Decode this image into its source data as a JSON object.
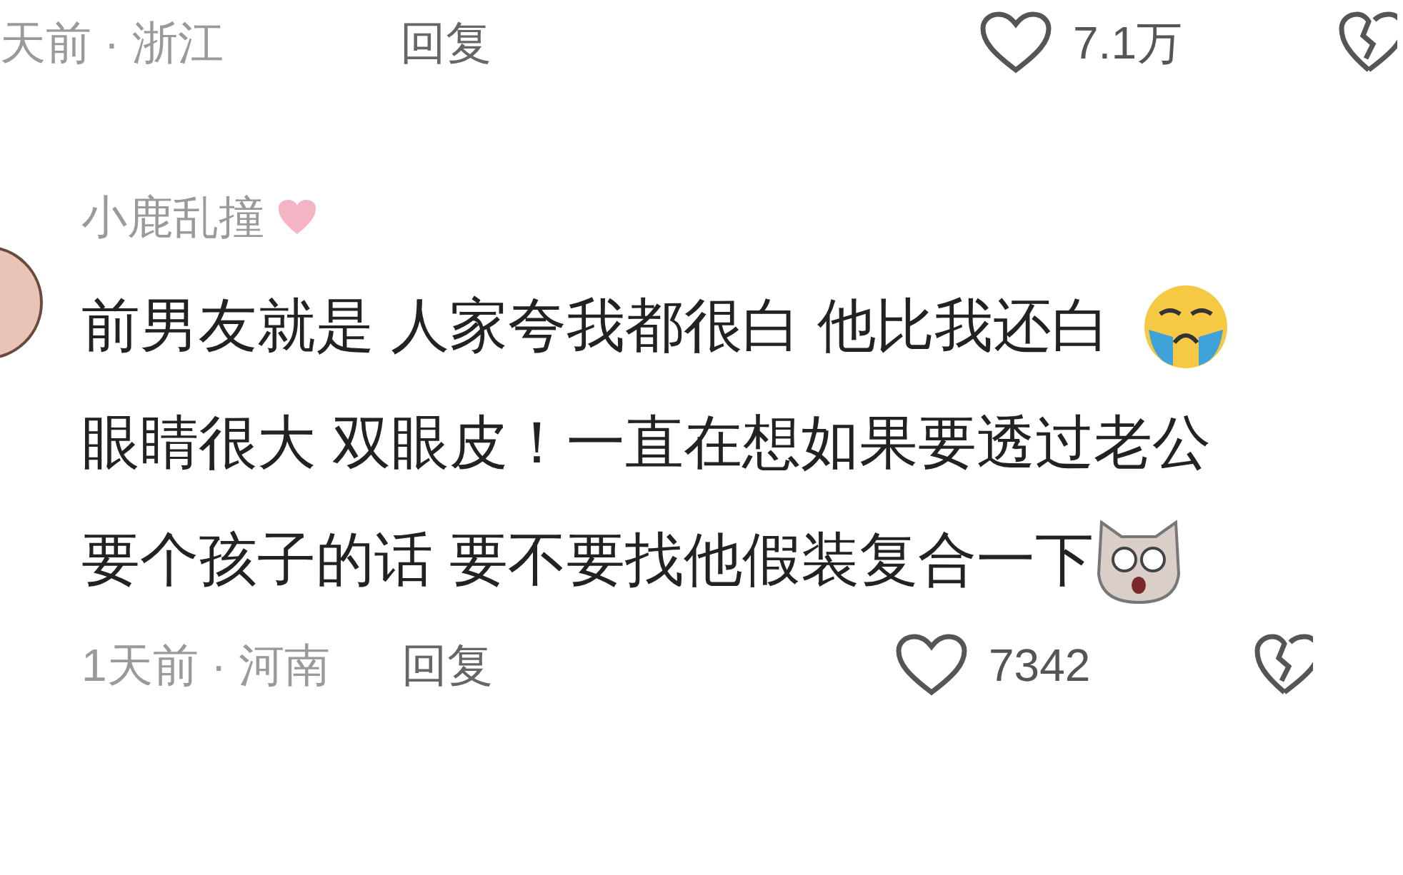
{
  "previous_comment": {
    "time_location": "天前 · 浙江",
    "reply": "回复",
    "likes": "7.1万"
  },
  "comment": {
    "username": "小鹿乱撞",
    "lines": [
      [
        {
          "kind": "text",
          "text": "前男友就是 人家夸我都很白 他比我还白"
        },
        {
          "kind": "emoji_cry"
        }
      ],
      [
        {
          "kind": "text",
          "text": "眼睛很大 双眼皮！一直在想如果要透过老公"
        }
      ],
      [
        {
          "kind": "text",
          "text": "要个孩子的话 要不要找他假装复合一下"
        },
        {
          "kind": "emoji_dog"
        }
      ]
    ],
    "time_location": "1天前 · 河南",
    "reply": "回复",
    "likes": "7342"
  }
}
